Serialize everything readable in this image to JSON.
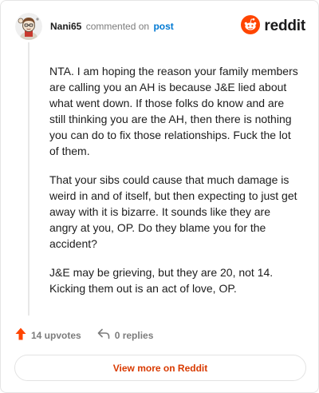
{
  "comment": {
    "username": "Nani65",
    "verb": "commented on",
    "post_link": "post",
    "paragraphs": [
      "NTA. I am hoping the reason your family members are calling you an AH is because J&E lied about what went down. If those folks do know and are still thinking you are the AH, then there is nothing you can do to fix those relationships. Fuck the lot of them.",
      "That your sibs could cause that much damage is weird in and of itself, but then expecting to just get away with it is bizarre. It sounds like they are angry at you, OP. Do they blame you for the accident?",
      "J&E may be grieving, but they are 20, not 14. Kicking them out is an act of love, OP."
    ]
  },
  "brand": {
    "wordmark": "reddit",
    "icon": "reddit-snoo-icon",
    "color": "#ff4500"
  },
  "actions": {
    "upvotes": "14 upvotes",
    "replies": "0 replies",
    "upvote_icon": "upvote-arrow-icon",
    "reply_icon": "reply-arrow-icon",
    "upvote_color": "#ff4500"
  },
  "footer": {
    "view_more": "View more on Reddit",
    "color": "#d93a00"
  }
}
